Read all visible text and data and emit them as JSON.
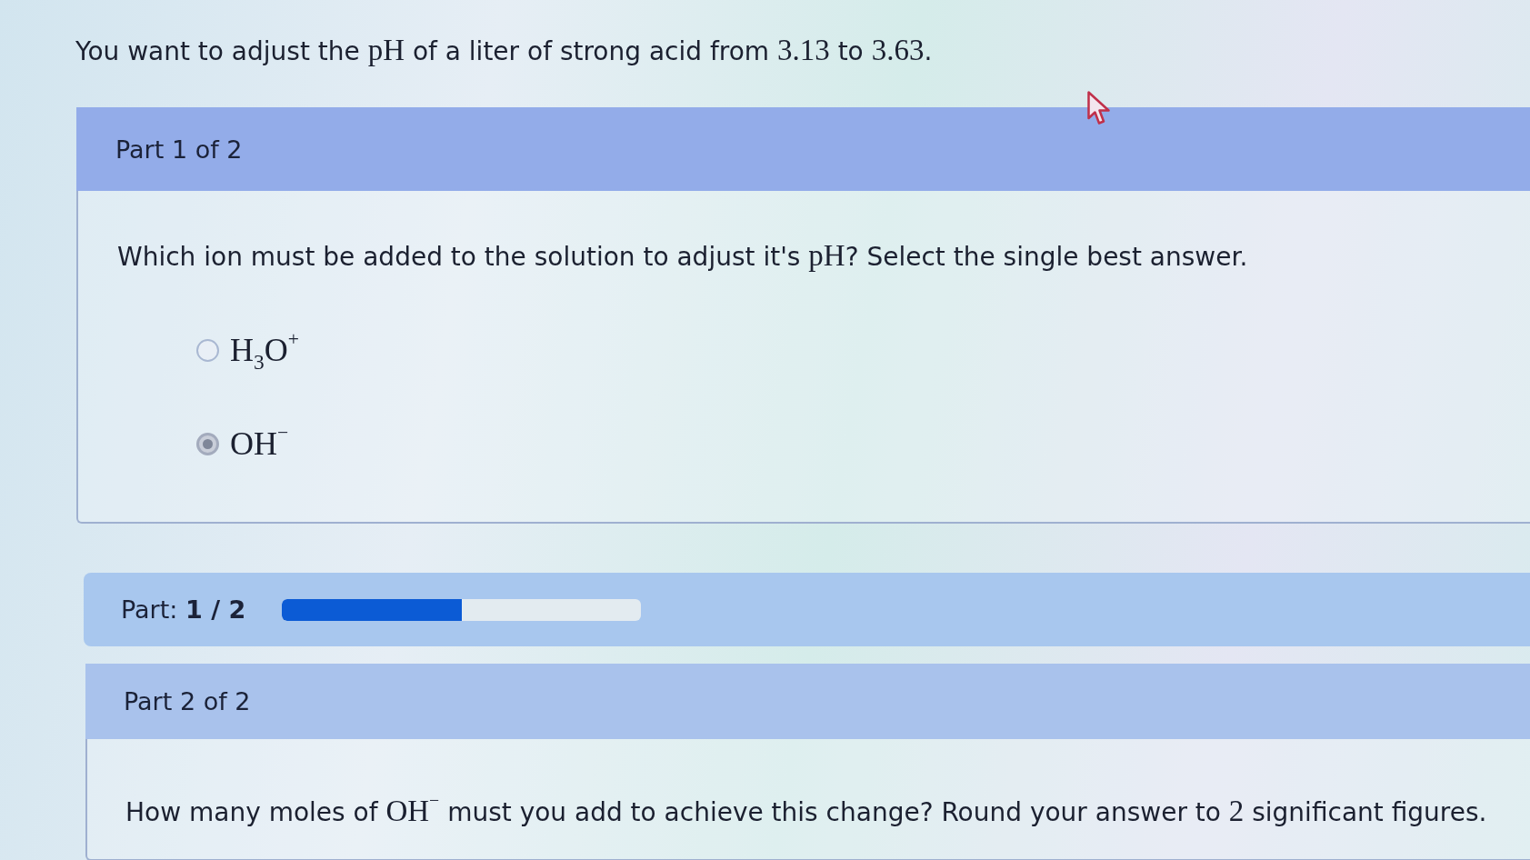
{
  "question": {
    "segments": [
      {
        "kind": "text",
        "text": "You want to adjust the "
      },
      {
        "kind": "math",
        "text": "pH"
      },
      {
        "kind": "text",
        "text": " of a liter of strong acid from "
      },
      {
        "kind": "math",
        "text": "3.13"
      },
      {
        "kind": "text",
        "text": " to "
      },
      {
        "kind": "math",
        "text": "3.63"
      },
      {
        "kind": "text",
        "text": "."
      }
    ]
  },
  "part_1": {
    "header": "Part 1 of 2",
    "prompt": [
      {
        "kind": "text",
        "text": "Which ion must be added to the solution to adjust it's "
      },
      {
        "kind": "math",
        "text": "pH"
      },
      {
        "kind": "text",
        "text": "? Select the single best answer."
      }
    ],
    "options": [
      {
        "label": "H$_{3}$O$^{+}$",
        "selected": false
      },
      {
        "label": "OH$^{−}$",
        "selected": true
      }
    ]
  },
  "progress": {
    "label": "Part: **1 / 2**",
    "level": 0.5
  },
  "part_2": {
    "header": "Part 2 of 2",
    "prompt": [
      {
        "kind": "text",
        "text": "How many moles of "
      },
      {
        "kind": "math",
        "text": "OH$^{−}$"
      },
      {
        "kind": "text",
        "text": " must you add to achieve this change? Round your answer to "
      },
      {
        "kind": "math",
        "text": "2"
      },
      {
        "kind": "text",
        "text": " significant figures."
      }
    ]
  }
}
